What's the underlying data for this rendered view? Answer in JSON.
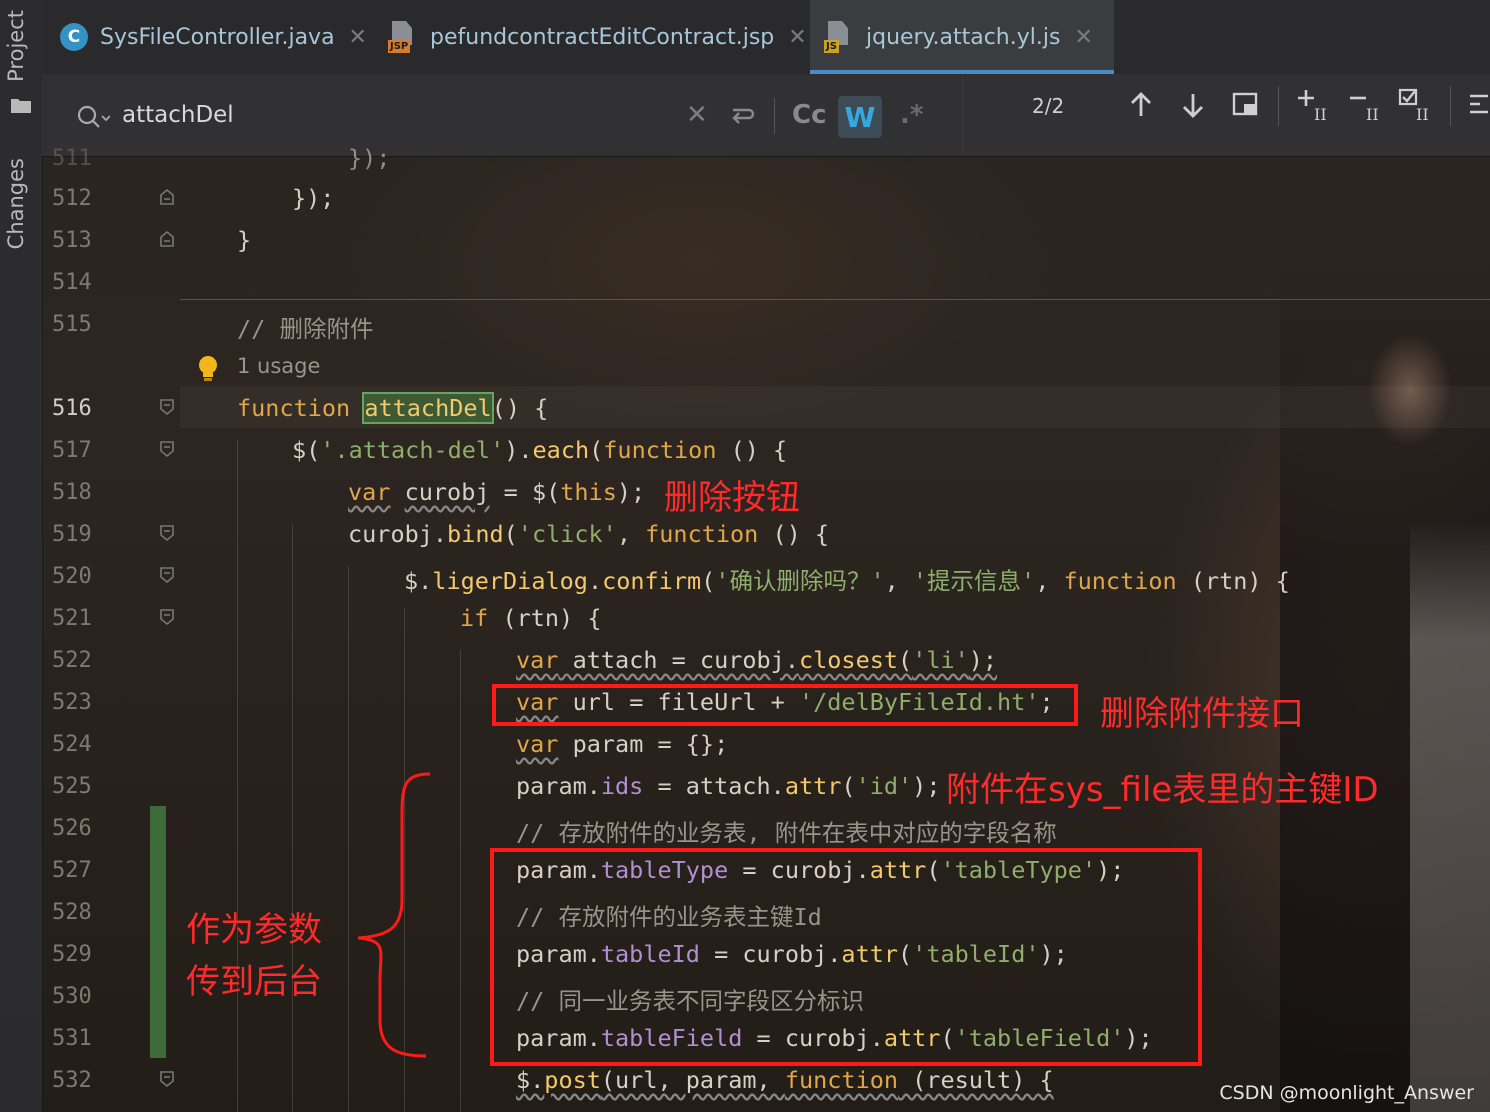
{
  "tool_window": {
    "project_label": "Project",
    "changes_label": "Changes"
  },
  "tabs": [
    {
      "label": "SysFileController.java",
      "type": "java"
    },
    {
      "label": "pefundcontractEditContract.jsp",
      "type": "jsp",
      "badge": "JSP"
    },
    {
      "label": "jquery.attach.yl.js",
      "type": "js",
      "badge": "JS",
      "active": true
    }
  ],
  "search": {
    "query": "attachDel",
    "match_count": "2/2",
    "case_label": "Cc",
    "word_label": "W",
    "regex_label": ".*"
  },
  "gutter": {
    "lines": [
      "511",
      "512",
      "513",
      "514",
      "515",
      "",
      "516",
      "517",
      "518",
      "519",
      "520",
      "521",
      "522",
      "523",
      "524",
      "525",
      "526",
      "527",
      "528",
      "529",
      "530",
      "531",
      "532"
    ],
    "current_line": "516"
  },
  "code": {
    "l512": "});",
    "l513": "}",
    "l515_comment": "// 删除附件",
    "usage": "1 usage",
    "l516_kw": "function",
    "l516_name": "attachDel",
    "l516_rest": "() {",
    "l517_a": "$(",
    "l517_str": "'.attach-del'",
    "l517_b": ").",
    "l517_each": "each",
    "l517_c": "(",
    "l517_kw": "function",
    "l517_d": " () {",
    "l518_kw": "var",
    "l518_var": "curobj",
    "l518_rest": " = $(",
    "l518_this": "this",
    "l518_end": ");",
    "l519_a": "curobj.",
    "l519_bind": "bind",
    "l519_b": "(",
    "l519_str": "'click'",
    "l519_c": ", ",
    "l519_kw": "function",
    "l519_d": " () {",
    "l520_a": "$.",
    "l520_fn": "ligerDialog",
    "l520_b": ".",
    "l520_confirm": "confirm",
    "l520_c": "(",
    "l520_str1": "'确认删除吗？'",
    "l520_d": ", ",
    "l520_str2": "'提示信息'",
    "l520_e": ", ",
    "l520_kw": "function",
    "l520_f": " (rtn) {",
    "l521_kw": "if",
    "l521_rest": " (rtn) {",
    "l522_kw": "var",
    "l522_rest": " attach = curobj.",
    "l522_fn": "closest",
    "l522_b": "(",
    "l522_str": "'li'",
    "l522_end": ");",
    "l523_kw": "var",
    "l523_rest": " url = fileUrl + ",
    "l523_str": "'/delByFileId.ht'",
    "l523_end": ";",
    "l524_kw": "var",
    "l524_rest": " param = {};",
    "l525_a": "param.",
    "l525_prop": "ids",
    "l525_b": " = attach.",
    "l525_fn": "attr",
    "l525_c": "(",
    "l525_str": "'id'",
    "l525_end": ");",
    "l526_comment": "// 存放附件的业务表, 附件在表中对应的字段名称",
    "l527_a": "param.",
    "l527_prop": "tableType",
    "l527_b": " = curobj.",
    "l527_fn": "attr",
    "l527_c": "(",
    "l527_str": "'tableType'",
    "l527_end": ");",
    "l528_comment": "// 存放附件的业务表主键Id",
    "l529_a": "param.",
    "l529_prop": "tableId",
    "l529_b": " = curobj.",
    "l529_fn": "attr",
    "l529_c": "(",
    "l529_str": "'tableId'",
    "l529_end": ");",
    "l530_comment": "// 同一业务表不同字段区分标识",
    "l531_a": "param.",
    "l531_prop": "tableField",
    "l531_b": " = curobj.",
    "l531_fn": "attr",
    "l531_c": "(",
    "l531_str": "'tableField'",
    "l531_end": ");",
    "l532_a": "$.",
    "l532_fn": "post",
    "l532_b": "(url, param, ",
    "l532_kw": "function",
    "l532_c": " (result) {"
  },
  "annotations": {
    "delete_button": "删除按钮",
    "delete_api": "删除附件接口",
    "primary_key": "附件在sys_file表里的主键ID",
    "as_params_line1": "作为参数",
    "as_params_line2": "传到后台"
  },
  "watermark": "CSDN @moonlight_Answer",
  "colors": {
    "keyword": "#e0a74a",
    "string": "#8fae6c",
    "function": "#f2c96b",
    "property": "#b48ed2",
    "annotation": "#ff2a2a",
    "active_tab_underline": "#4a88c7"
  }
}
